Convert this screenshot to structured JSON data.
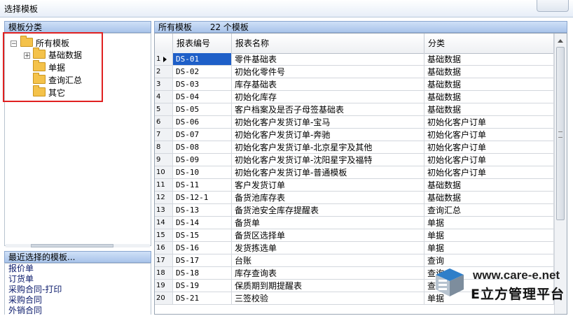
{
  "window": {
    "title": "选择模板"
  },
  "left_pane": {
    "header": "模板分类",
    "tree": [
      {
        "label": "所有模板",
        "expander": "⊟",
        "level": 0
      },
      {
        "label": "基础数据",
        "expander": "⊞",
        "level": 1
      },
      {
        "label": "单据",
        "level": 1
      },
      {
        "label": "查询汇总",
        "level": 1
      },
      {
        "label": "其它",
        "level": 1
      }
    ]
  },
  "recent_pane": {
    "header": "最近选择的模板...",
    "items": [
      "报价单",
      "订货单",
      "采购合同-打印",
      "采购合同",
      "外销合同"
    ]
  },
  "right_pane": {
    "header_title": "所有模板",
    "header_count": "22 个模板",
    "columns": [
      "报表编号",
      "报表名称",
      "分类"
    ],
    "rows": [
      {
        "num": "1",
        "code": "DS-01",
        "name": "零件基础表",
        "category": "基础数据",
        "selected": true
      },
      {
        "num": "2",
        "code": "DS-02",
        "name": "初始化零件号",
        "category": "基础数据"
      },
      {
        "num": "3",
        "code": "DS-03",
        "name": "库存基础表",
        "category": "基础数据"
      },
      {
        "num": "4",
        "code": "DS-04",
        "name": "初始化库存",
        "category": "基础数据"
      },
      {
        "num": "5",
        "code": "DS-05",
        "name": "客户档案及是否子母签基础表",
        "category": "基础数据"
      },
      {
        "num": "6",
        "code": "DS-06",
        "name": "初始化客户发货订单-宝马",
        "category": "初始化客户订单"
      },
      {
        "num": "7",
        "code": "DS-07",
        "name": "初始化客户发货订单-奔驰",
        "category": "初始化客户订单"
      },
      {
        "num": "8",
        "code": "DS-08",
        "name": "初始化客户发货订单-北京星宇及其他",
        "category": "初始化客户订单"
      },
      {
        "num": "9",
        "code": "DS-09",
        "name": "初始化客户发货订单-沈阳星宇及福特",
        "category": "初始化客户订单"
      },
      {
        "num": "10",
        "code": "DS-10",
        "name": "初始化客户发货订单-普通模板",
        "category": "初始化客户订单"
      },
      {
        "num": "11",
        "code": "DS-11",
        "name": "客户发货订单",
        "category": "基础数据"
      },
      {
        "num": "12",
        "code": "DS-12-1",
        "name": "备货池库存表",
        "category": "基础数据"
      },
      {
        "num": "13",
        "code": "DS-13",
        "name": "备货池安全库存提醒表",
        "category": "查询汇总"
      },
      {
        "num": "14",
        "code": "DS-14",
        "name": "备货单",
        "category": "单据"
      },
      {
        "num": "15",
        "code": "DS-15",
        "name": "备货区选择单",
        "category": "单据"
      },
      {
        "num": "16",
        "code": "DS-16",
        "name": "发货拣选单",
        "category": "单据"
      },
      {
        "num": "17",
        "code": "DS-17",
        "name": "台账",
        "category": "查询"
      },
      {
        "num": "18",
        "code": "DS-18",
        "name": "库存查询表",
        "category": "查询"
      },
      {
        "num": "19",
        "code": "DS-19",
        "name": "保质期到期提醒表",
        "category": "查"
      },
      {
        "num": "20",
        "code": "DS-21",
        "name": "三签校验",
        "category": "单据"
      }
    ]
  },
  "watermark": {
    "site": "www.care-e.net",
    "brand": "E立方管理平台"
  },
  "colors": {
    "selection": "#1e5fc8",
    "highlight_box": "#e02020",
    "header_blue": "#a9c4ea"
  }
}
